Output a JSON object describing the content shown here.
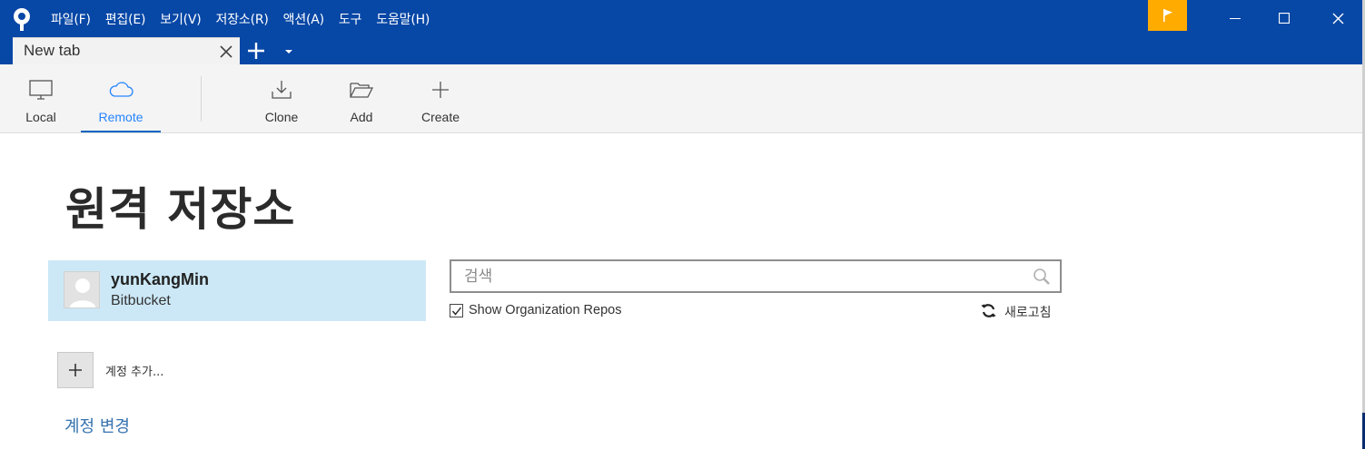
{
  "menubar": {
    "items": [
      "파일(F)",
      "편집(E)",
      "보기(V)",
      "저장소(R)",
      "액션(A)",
      "도구",
      "도움말(H)"
    ]
  },
  "tabs": {
    "active_label": "New tab"
  },
  "toolbar": {
    "local_label": "Local",
    "remote_label": "Remote",
    "clone_label": "Clone",
    "add_label": "Add",
    "create_label": "Create"
  },
  "main": {
    "title": "원격 저장소",
    "account": {
      "name": "yunKangMin",
      "host": "Bitbucket"
    },
    "add_account_label": "계정 추가...",
    "change_account_label": "계정 변경",
    "search": {
      "placeholder": "검색",
      "value": ""
    },
    "show_org_repos": {
      "label": "Show Organization Repos",
      "checked": true
    },
    "refresh_label": "새로고침"
  },
  "colors": {
    "titlebar": "#0747a6",
    "flag": "#ffab00",
    "account_card": "#cce8f7",
    "link": "#3572b0",
    "remote_active": "#2684ff"
  },
  "icons": {
    "app": "sourcetree-logo-icon",
    "flag": "flag-icon",
    "search": "search-icon",
    "refresh": "refresh-icon"
  }
}
